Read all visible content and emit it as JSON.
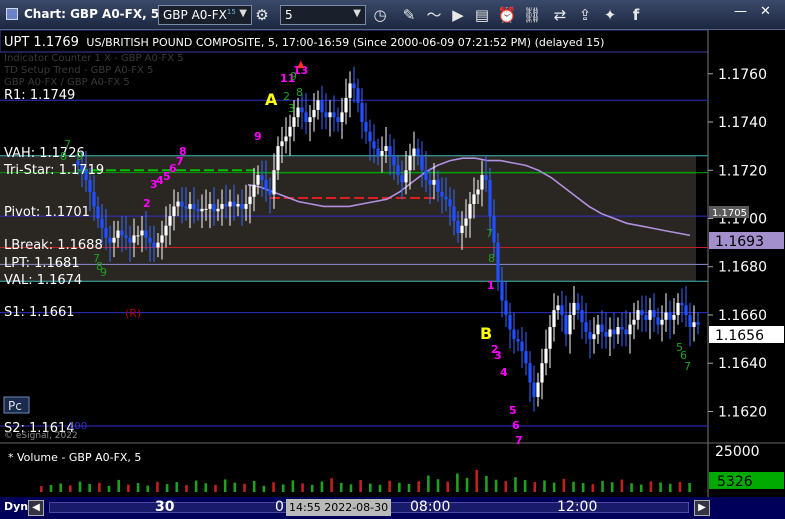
{
  "window": {
    "title": "Chart: GBP A0-FX, 5",
    "symbol": "GBP A0-FX",
    "symbol_sup": "15",
    "interval": "5",
    "minimize": "—",
    "close": "✕"
  },
  "chart_header": {
    "overlay_label": "UPT 1.1769",
    "description": "US/BRITISH POUND COMPOSITE, 5, 17:00-16:59 (Since 2000-06-09 07:21:52 PM) (delayed 15)",
    "ghost_line_1": "Indicator Counter 1 X - GBP A0-FX 5",
    "ghost_line_2": "TD Setup Trend - GBP A0-FX 5",
    "ghost_line_3": "GBP A0-FX / GBP A0-FX 5"
  },
  "levels": [
    {
      "label": "R1: 1.1749",
      "price": 1.1749,
      "color": "#3030c8"
    },
    {
      "label": "VAH: 1.1726",
      "price": 1.1726,
      "color": "#40b8b8"
    },
    {
      "label": "Tri-Star: 1.1719",
      "price": 1.1719,
      "color": "#00a000"
    },
    {
      "label": "Pivot: 1.1701",
      "price": 1.1701,
      "color": "#3030c8"
    },
    {
      "label": "LBreak: 1.1688",
      "price": 1.1688,
      "color": "#c02020"
    },
    {
      "label": "LPT: 1.1681",
      "price": 1.1681,
      "color": "#9090d0"
    },
    {
      "label": "VAL: 1.1674",
      "price": 1.1674,
      "color": "#40b8b8"
    },
    {
      "label": "S1: 1.1661",
      "price": 1.1661,
      "color": "#3030c8"
    },
    {
      "label": "S2: 1.1614",
      "price": 1.1614,
      "color": "#3030c8"
    }
  ],
  "annotations": {
    "A": "A",
    "B": "B",
    "R": "(R)",
    "pc": "Pc",
    "copyright": "© eSignal, 2022",
    "s2_tag": "100"
  },
  "price_badges": {
    "last": "1.1656",
    "ma": "1.1693",
    "small": "1.1705"
  },
  "volume": {
    "label": "* Volume - GBP A0-FX, 5",
    "axis_max": "25000",
    "last": "5326"
  },
  "bottom": {
    "dyn": "Dyn",
    "cursor_time": "14:55 2022-08-30",
    "x_ticks": [
      {
        "label": "30",
        "bold": true
      },
      {
        "label": "0",
        "bold": false
      },
      {
        "label": "08:00",
        "bold": false
      },
      {
        "label": "12:00",
        "bold": false
      }
    ]
  },
  "chart_data": {
    "type": "candlestick",
    "y_axis": {
      "ticks": [
        "1.1760",
        "1.1740",
        "1.1720",
        "1.1700",
        "1.1680",
        "1.1660",
        "1.1640",
        "1.1620"
      ],
      "ylim": [
        1.1609,
        1.1774
      ]
    },
    "series": [
      {
        "name": "GBP A0-FX",
        "close": [
          1.1722,
          1.172,
          1.1716,
          1.1711,
          1.1705,
          1.17,
          1.1696,
          1.1692,
          1.169,
          1.1692,
          1.1695,
          1.1693,
          1.1692,
          1.169,
          1.1693,
          1.1693,
          1.1695,
          1.1692,
          1.169,
          1.1688,
          1.169,
          1.1693,
          1.1697,
          1.1701,
          1.1705,
          1.1707,
          1.1705,
          1.1704,
          1.1706,
          1.1704,
          1.1703,
          1.1704,
          1.1704,
          1.1706,
          1.1703,
          1.1704,
          1.1706,
          1.1705,
          1.1707,
          1.1705,
          1.1706,
          1.1704,
          1.1706,
          1.1709,
          1.1714,
          1.1718,
          1.1716,
          1.1712,
          1.171,
          1.172,
          1.173,
          1.1732,
          1.1734,
          1.1738,
          1.1742,
          1.1746,
          1.1744,
          1.174,
          1.1742,
          1.1745,
          1.1749,
          1.1744,
          1.1742,
          1.1744,
          1.1742,
          1.174,
          1.1744,
          1.175,
          1.1756,
          1.1754,
          1.1748,
          1.174,
          1.1736,
          1.1732,
          1.1729,
          1.1726,
          1.1728,
          1.173,
          1.1726,
          1.1722,
          1.1718,
          1.1715,
          1.172,
          1.1726,
          1.1729,
          1.1726,
          1.172,
          1.1716,
          1.1714,
          1.1716,
          1.1711,
          1.1709,
          1.1708,
          1.1705,
          1.1699,
          1.1694,
          1.1697,
          1.17,
          1.1706,
          1.171,
          1.1712,
          1.1718,
          1.1716,
          1.1701,
          1.169,
          1.1674,
          1.1666,
          1.166,
          1.1654,
          1.165,
          1.1649,
          1.1645,
          1.164,
          1.1632,
          1.1626,
          1.1632,
          1.164,
          1.1646,
          1.1655,
          1.1662,
          1.1664,
          1.166,
          1.1652,
          1.166,
          1.1665,
          1.1662,
          1.1657,
          1.1653,
          1.165,
          1.1652,
          1.1656,
          1.1653,
          1.1651,
          1.1654,
          1.1652,
          1.1655,
          1.1654,
          1.1652,
          1.1656,
          1.1658,
          1.1662,
          1.166,
          1.1658,
          1.1662,
          1.1659,
          1.1656,
          1.1658,
          1.1661,
          1.1658,
          1.166,
          1.1665,
          1.1664,
          1.166,
          1.1655,
          1.1657,
          1.1656
        ]
      },
      {
        "name": "Moving Average",
        "values": [
          1.1714,
          1.1713,
          1.1711,
          1.1709,
          1.1707,
          1.1706,
          1.1705,
          1.1705,
          1.1705,
          1.1706,
          1.1707,
          1.1708,
          1.1711,
          1.1715,
          1.1719,
          1.1722,
          1.1724,
          1.1725,
          1.1725,
          1.1724,
          1.1724,
          1.1723,
          1.1722,
          1.172,
          1.1717,
          1.1713,
          1.1709,
          1.1705,
          1.1702,
          1.17,
          1.1698,
          1.1697,
          1.1696,
          1.1695,
          1.1694,
          1.1693
        ]
      },
      {
        "name": "Volume",
        "values": [
          3500,
          4200,
          5100,
          3900,
          6200,
          4800,
          5500,
          3600,
          7200,
          4400,
          5300,
          3800,
          6100,
          4700,
          5900,
          4100,
          6800,
          5200,
          4300,
          7500,
          5600,
          4900,
          6600,
          3700,
          5800,
          4500,
          6900,
          5100,
          4200,
          6300,
          8200,
          5400,
          4600,
          7100,
          5000,
          4300,
          6700,
          5500,
          4800,
          6400,
          9800,
          7600,
          6200,
          11000,
          8400,
          13200,
          9600,
          7300,
          6500,
          8800,
          7100,
          5900,
          6900,
          5600,
          7800,
          6100,
          5300,
          4700,
          6600,
          5800,
          7400,
          5200,
          4400,
          6300,
          5700,
          4900,
          6000,
          5326
        ]
      }
    ]
  }
}
